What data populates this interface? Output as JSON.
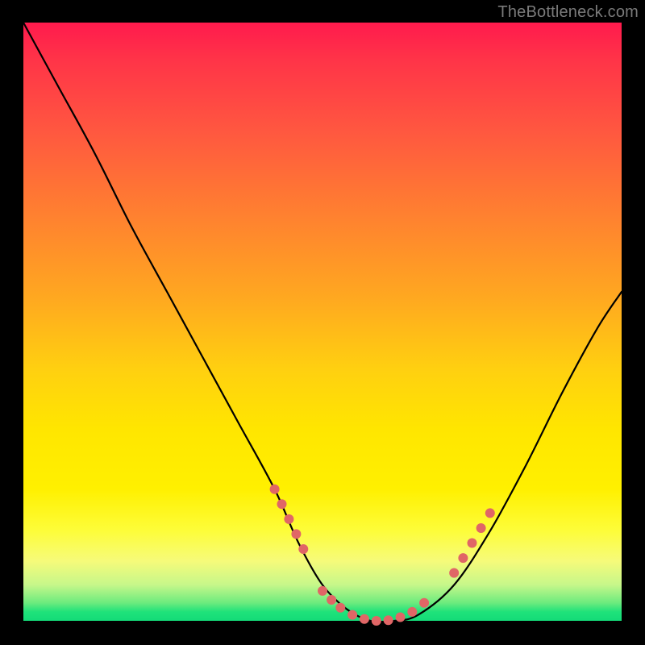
{
  "watermark": "TheBottleneck.com",
  "chart_data": {
    "type": "line",
    "title": "",
    "xlabel": "",
    "ylabel": "",
    "xlim": [
      0,
      100
    ],
    "ylim": [
      0,
      100
    ],
    "series": [
      {
        "name": "bottleneck-curve",
        "x": [
          0,
          6,
          12,
          18,
          24,
          30,
          36,
          42,
          46,
          50,
          54,
          58,
          62,
          66,
          72,
          78,
          84,
          90,
          96,
          100
        ],
        "values": [
          100,
          89,
          78,
          66,
          55,
          44,
          33,
          22,
          13,
          6,
          2,
          0,
          0,
          1,
          6,
          15,
          26,
          38,
          49,
          55
        ]
      }
    ],
    "highlight_clusters": [
      {
        "name": "left-descent-dots",
        "points": [
          {
            "x": 42,
            "y": 22
          },
          {
            "x": 43.2,
            "y": 19.5
          },
          {
            "x": 44.4,
            "y": 17
          },
          {
            "x": 45.6,
            "y": 14.5
          },
          {
            "x": 46.8,
            "y": 12
          }
        ]
      },
      {
        "name": "valley-dots",
        "points": [
          {
            "x": 50,
            "y": 5
          },
          {
            "x": 51.5,
            "y": 3.5
          },
          {
            "x": 53,
            "y": 2.2
          },
          {
            "x": 55,
            "y": 1.0
          },
          {
            "x": 57,
            "y": 0.3
          },
          {
            "x": 59,
            "y": 0.0
          },
          {
            "x": 61,
            "y": 0.1
          },
          {
            "x": 63,
            "y": 0.6
          },
          {
            "x": 65,
            "y": 1.5
          },
          {
            "x": 67,
            "y": 3.0
          }
        ]
      },
      {
        "name": "right-rise-dots",
        "points": [
          {
            "x": 72,
            "y": 8
          },
          {
            "x": 73.5,
            "y": 10.5
          },
          {
            "x": 75,
            "y": 13
          },
          {
            "x": 76.5,
            "y": 15.5
          },
          {
            "x": 78,
            "y": 18
          }
        ]
      }
    ],
    "colors": {
      "curve": "#000000",
      "dots": "#e06666",
      "background_top": "#ff1a4d",
      "background_mid": "#ffe600",
      "background_bottom": "#14db78"
    }
  }
}
